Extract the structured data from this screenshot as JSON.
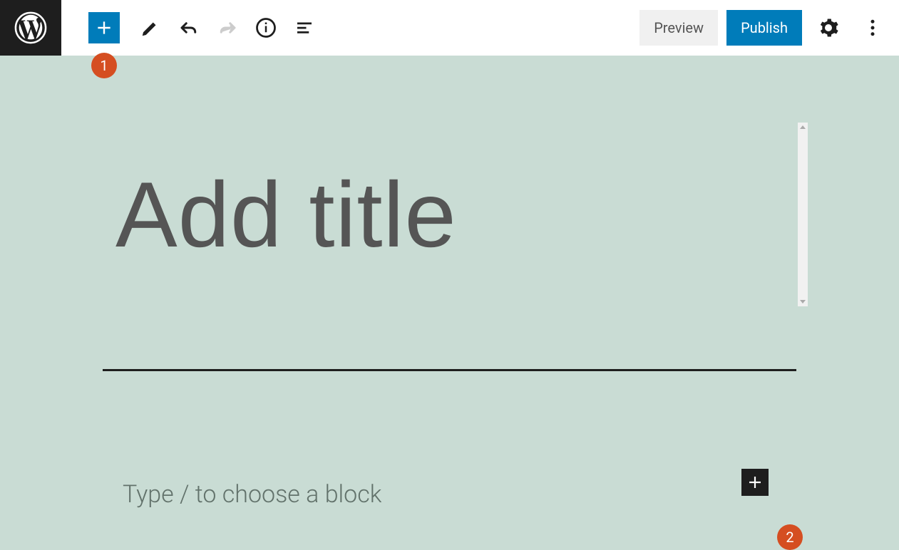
{
  "toolbar": {
    "preview_label": "Preview",
    "publish_label": "Publish"
  },
  "editor": {
    "title_placeholder": "Add title",
    "content_placeholder": "Type / to choose a block"
  },
  "annotations": {
    "badge1": "1",
    "badge2": "2"
  }
}
